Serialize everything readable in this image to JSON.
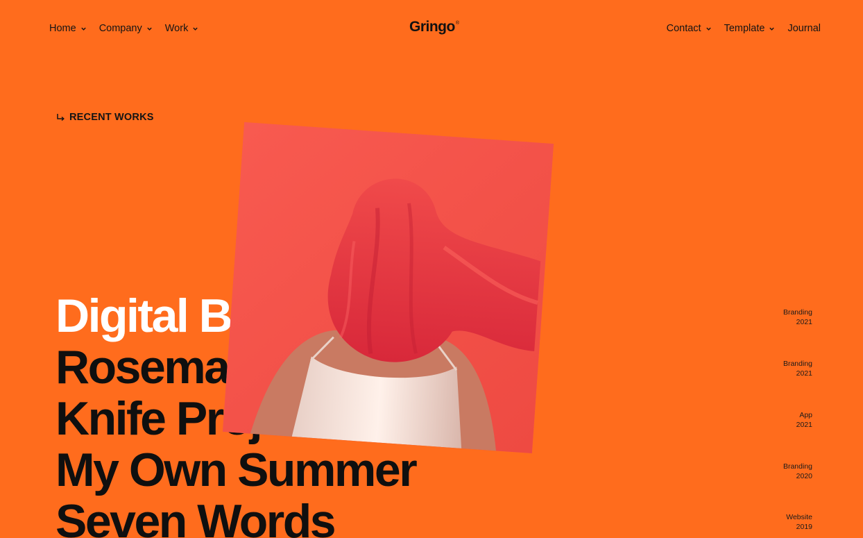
{
  "brand": {
    "logo": "Gringo",
    "registered": "®"
  },
  "nav": {
    "left": [
      {
        "label": "Home",
        "has_dropdown": true
      },
      {
        "label": "Company",
        "has_dropdown": true
      },
      {
        "label": "Work",
        "has_dropdown": true
      }
    ],
    "right": [
      {
        "label": "Contact",
        "has_dropdown": true
      },
      {
        "label": "Template",
        "has_dropdown": true
      },
      {
        "label": "Journal",
        "has_dropdown": false
      }
    ]
  },
  "section": {
    "label": "RECENT WORKS",
    "icon": "return-arrow-icon"
  },
  "works": [
    {
      "title": "Digital Brand",
      "category": "Branding",
      "year": "2021",
      "active": true
    },
    {
      "title": "Rosemary",
      "category": "Branding",
      "year": "2021",
      "active": false
    },
    {
      "title": "Knife Project",
      "category": "App",
      "year": "2021",
      "active": false
    },
    {
      "title": "My Own Summer",
      "category": "Branding",
      "year": "2020",
      "active": false
    },
    {
      "title": "Seven Words",
      "category": "Website",
      "year": "2019",
      "active": false
    }
  ],
  "colors": {
    "background": "#ff6c1d",
    "active_title": "#ffffff",
    "text": "#111111"
  }
}
